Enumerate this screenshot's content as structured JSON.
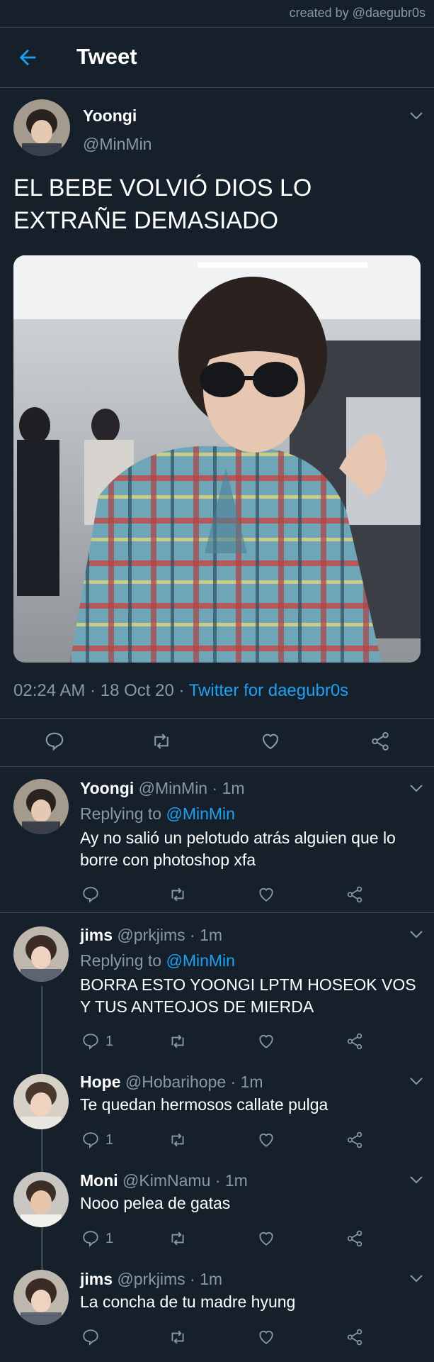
{
  "credit": "created by @daegubr0s",
  "header": {
    "title": "Tweet"
  },
  "tweet": {
    "name": "Yoongi",
    "handle": "@MinMin",
    "text": "EL BEBE VOLVIÓ DIOS LO EXTRAÑE DEMASIADO",
    "time": "02:24 AM",
    "date": "18 Oct 20",
    "sep": "·",
    "source": "Twitter for daegubr0s"
  },
  "replies": [
    {
      "name": "Yoongi",
      "handle": "@MinMin",
      "time": "1m",
      "replying_label": "Replying to",
      "replying_to": "@MinMin",
      "lines": [
        "Ay no salió un pelotudo atrás alguien que lo",
        "borre con photoshop xfa"
      ],
      "reply_count": ""
    },
    {
      "name": "jims",
      "handle": "@prkjims",
      "time": "1m",
      "replying_label": "Replying to",
      "replying_to": "@MinMin",
      "lines": [
        "BORRA ESTO YOONGI LPTM HOSEOK VOS",
        "Y TUS ANTEOJOS DE MIERDA"
      ],
      "reply_count": "1"
    },
    {
      "name": "Hope",
      "handle": "@Hobarihope",
      "time": "1m",
      "lines": [
        "Te quedan hermosos callate pulga"
      ],
      "reply_count": "1"
    },
    {
      "name": "Moni",
      "handle": "@KimNamu",
      "time": "1m",
      "lines": [
        "Nooo pelea de gatas"
      ],
      "reply_count": "1"
    },
    {
      "name": "jims",
      "handle": "@prkjims",
      "time": "1m",
      "lines": [
        "La concha de tu madre hyung"
      ],
      "reply_count": ""
    }
  ],
  "icons": {
    "back": "arrow-left-icon",
    "reply": "reply-icon",
    "retweet": "retweet-icon",
    "like": "like-icon",
    "share": "share-icon",
    "more": "chevron-down-icon"
  },
  "colors": {
    "background": "#15202b",
    "accent": "#1da1f2",
    "muted": "#8899a6",
    "divider": "#38444d"
  }
}
